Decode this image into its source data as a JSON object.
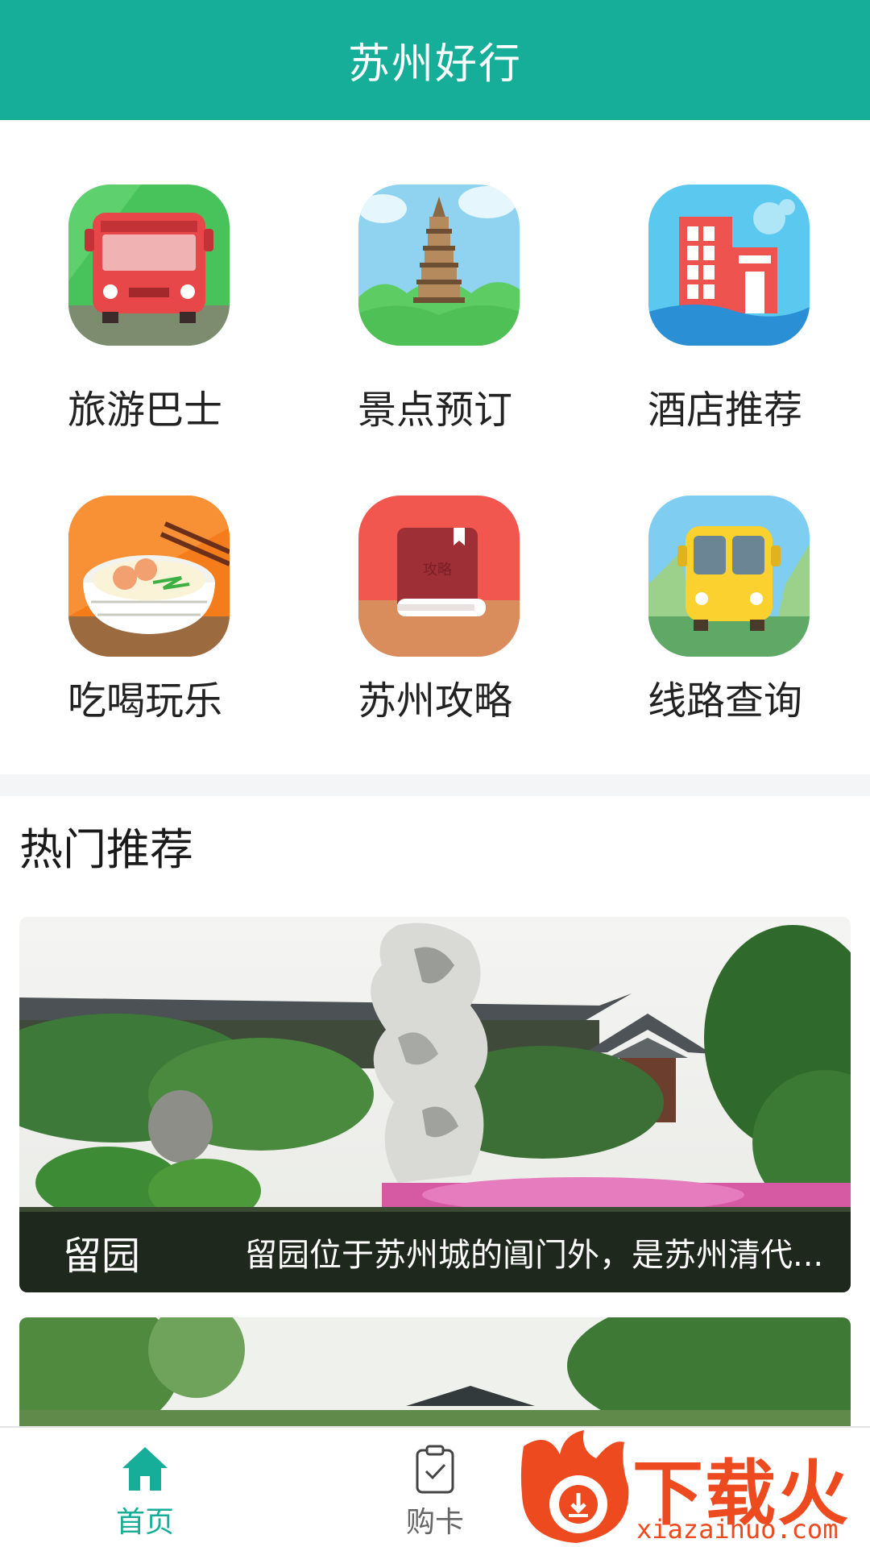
{
  "header": {
    "title": "苏州好行"
  },
  "grid": {
    "items": [
      {
        "label": "旅游巴士",
        "icon": "tour-bus-icon"
      },
      {
        "label": "景点预订",
        "icon": "pagoda-icon"
      },
      {
        "label": "酒店推荐",
        "icon": "hotel-icon"
      },
      {
        "label": "吃喝玩乐",
        "icon": "food-bowl-icon"
      },
      {
        "label": "苏州攻略",
        "icon": "guide-book-icon"
      },
      {
        "label": "线路查询",
        "icon": "route-bus-icon"
      }
    ]
  },
  "hot": {
    "title": "热门推荐",
    "cards": [
      {
        "name": "留园",
        "description": "留园位于苏州城的阊门外，是苏州清代..."
      }
    ]
  },
  "bottom_nav": {
    "items": [
      {
        "label": "首页",
        "icon": "home-icon",
        "active": true
      },
      {
        "label": "购卡",
        "icon": "clipboard-check-icon",
        "active": false
      }
    ],
    "accent": "#16ae99"
  },
  "watermark": {
    "text": "下载火",
    "url": "xiazaihuo.com"
  },
  "colors": {
    "primary": "#16ae99",
    "text": "#222222"
  }
}
